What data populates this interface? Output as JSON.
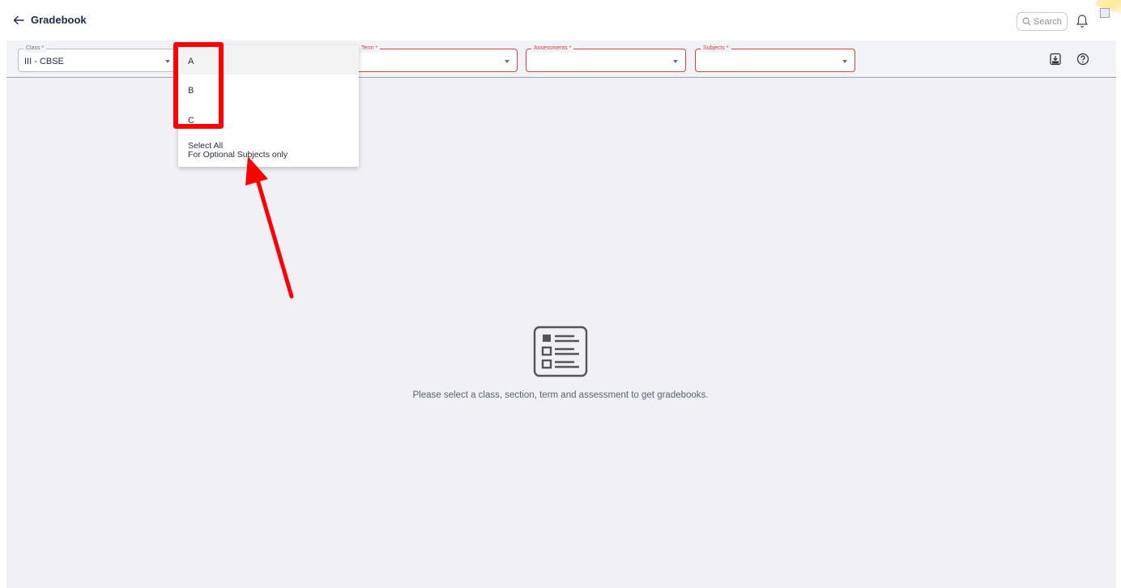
{
  "header": {
    "title": "Gradebook",
    "search_placeholder": "Search"
  },
  "filters": {
    "class": {
      "label": "Class *",
      "value": "III - CBSE"
    },
    "term": {
      "label": "Term *",
      "value": ""
    },
    "assessments": {
      "label": "Assessments *",
      "value": ""
    },
    "subjects": {
      "label": "Subjects *",
      "value": ""
    }
  },
  "dropdown": {
    "options": [
      "A",
      "B",
      "C"
    ],
    "select_all": "Select All",
    "select_all_note": "For Optional Subjects only"
  },
  "empty_state": {
    "message": "Please select a class, section, term and assessment to get gradebooks."
  },
  "colors": {
    "required_border": "#c74a3a",
    "annotation_red": "#ff0000",
    "page_bg": "#f1f1f5"
  },
  "icons": [
    "back-arrow-icon",
    "search-icon",
    "bell-icon",
    "avatar",
    "excel-download-icon",
    "help-icon",
    "list-document-icon"
  ]
}
